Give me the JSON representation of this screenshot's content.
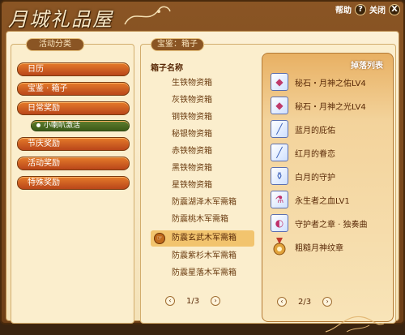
{
  "window": {
    "title": "月城礼品屋",
    "help_label": "帮助",
    "help_icon": "?",
    "close_label": "关闭",
    "close_icon": "X"
  },
  "categories": {
    "header": "活动分类",
    "items": [
      {
        "label": "日历"
      },
      {
        "label": "宝鉴 · 箱子"
      },
      {
        "label": "日常奖励"
      },
      {
        "label": "小喇叭激活",
        "sub": true
      },
      {
        "label": "节庆奖励"
      },
      {
        "label": "活动奖励"
      },
      {
        "label": "特殊奖励"
      }
    ]
  },
  "boxes": {
    "header": "宝鉴：箱子",
    "column_title": "箱子名称",
    "items": [
      "生铁物资箱",
      "灰铁物资箱",
      "钢铁物资箱",
      "秘银物资箱",
      "赤铁物资箱",
      "黑铁物资箱",
      "星铁物资箱",
      "防震湖泽木军需箱",
      "防震桃木军需箱",
      "防震玄武木军需箱",
      "防震紫杉木军需箱",
      "防震星落木军需箱"
    ],
    "selected_index": 9,
    "pager": {
      "text": "1/3",
      "prev": "‹",
      "next": "›"
    }
  },
  "drops": {
    "title": "掉落列表",
    "items": [
      {
        "label": "秘石・月神之佑LV4",
        "icon": "crystal-icon"
      },
      {
        "label": "秘石・月神之光LV4",
        "icon": "crystal-icon"
      },
      {
        "label": "蓝月的庇佑",
        "icon": "scroll-icon"
      },
      {
        "label": "红月的眷恋",
        "icon": "scroll-icon"
      },
      {
        "label": "白月的守护",
        "icon": "potion-icon"
      },
      {
        "label": "永生者之血LV1",
        "icon": "vial-icon"
      },
      {
        "label": "守护者之章 · 独奏曲",
        "icon": "shield-icon"
      },
      {
        "label": "粗糙月神纹章",
        "icon": "medal-icon"
      }
    ],
    "pager": {
      "text": "2/3",
      "prev": "‹",
      "next": "›"
    }
  },
  "colors": {
    "frame": "#8a5524",
    "content_bg": "#fcf1d6",
    "category_button": "#d3682a",
    "subcategory_button": "#4f6d24",
    "selected_row": "#f2c46e"
  }
}
